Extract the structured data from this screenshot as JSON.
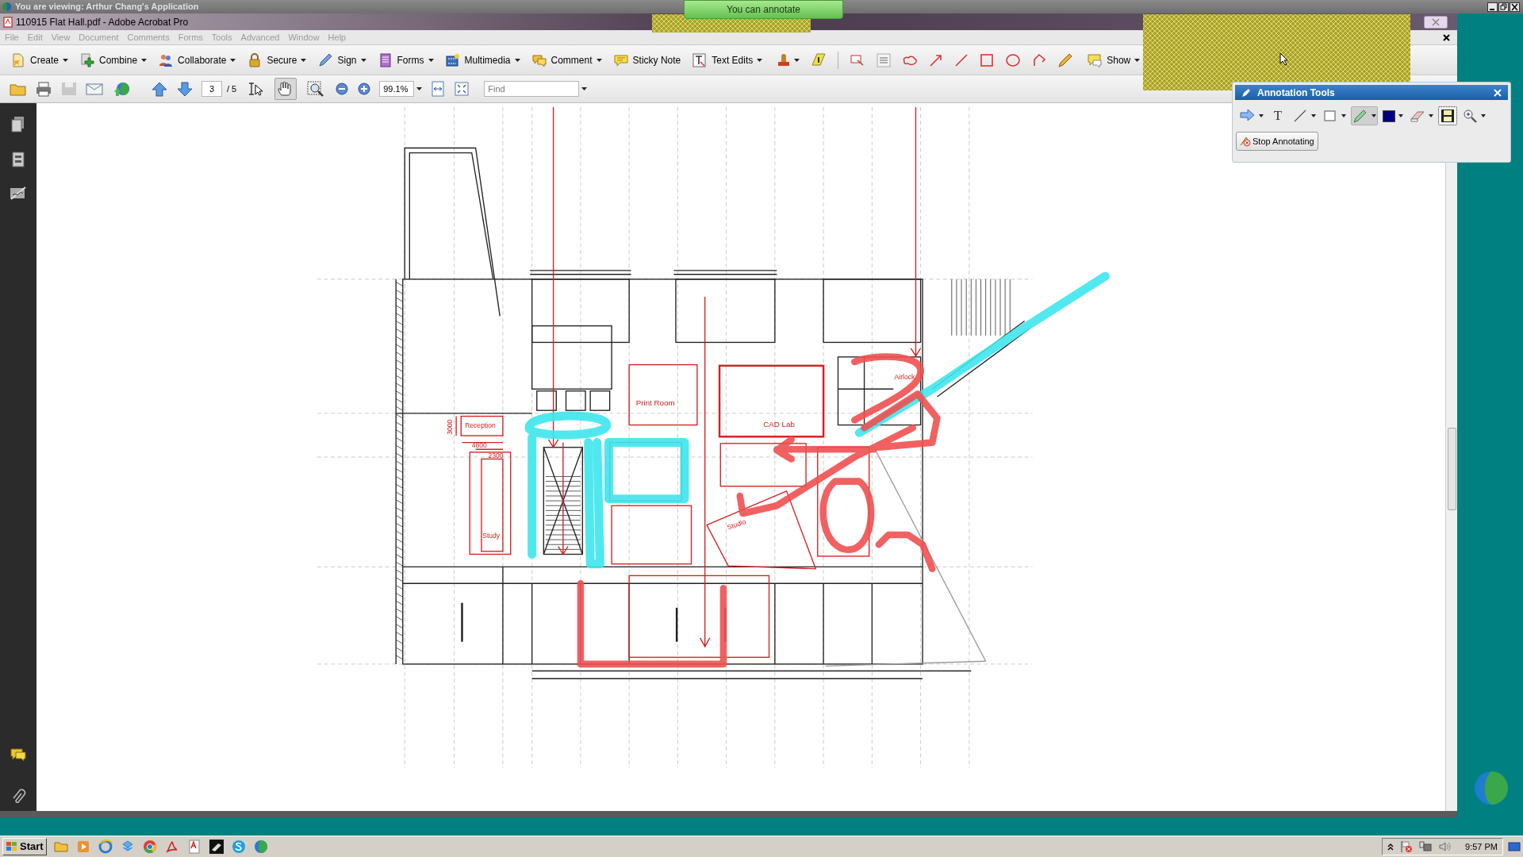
{
  "share_banner": {
    "text": "You are viewing: Arthur Chang's Application"
  },
  "toast": {
    "text": "You can annotate"
  },
  "window": {
    "title": "110915 Flat Hall.pdf - Adobe Acrobat Pro"
  },
  "menu": [
    {
      "label": "File",
      "disabled": true
    },
    {
      "label": "Edit",
      "disabled": true
    },
    {
      "label": "View",
      "disabled": true
    },
    {
      "label": "Document",
      "disabled": true
    },
    {
      "label": "Comments",
      "disabled": true
    },
    {
      "label": "Forms",
      "disabled": true
    },
    {
      "label": "Tools",
      "disabled": true
    },
    {
      "label": "Advanced",
      "disabled": true
    },
    {
      "label": "Window",
      "disabled": true
    },
    {
      "label": "Help",
      "disabled": true
    }
  ],
  "toolbar": [
    {
      "label": "Create",
      "dropdown": true
    },
    {
      "label": "Combine",
      "dropdown": true
    },
    {
      "label": "Collaborate",
      "dropdown": true
    },
    {
      "label": "Secure",
      "dropdown": true
    },
    {
      "label": "Sign",
      "dropdown": true
    },
    {
      "label": "Forms",
      "dropdown": true
    },
    {
      "label": "Multimedia",
      "dropdown": true
    },
    {
      "label": "Comment",
      "dropdown": true
    },
    {
      "label": "Sticky Note",
      "dropdown": false
    },
    {
      "label": "Text Edits",
      "dropdown": true
    },
    {
      "label": "Show",
      "dropdown": true
    }
  ],
  "navigation": {
    "page": "3",
    "page_count": "/ 5",
    "zoom": "99.1%",
    "find_placeholder": "Find"
  },
  "view_tools": [
    {
      "kind": "select",
      "selected": false
    },
    {
      "kind": "hand",
      "selected": true
    },
    {
      "kind": "zoom",
      "selected": false
    }
  ],
  "document": {
    "labels": [
      {
        "text": "Print Room"
      },
      {
        "text": "CAD Lab"
      },
      {
        "text": "Reception"
      },
      {
        "text": "Study"
      },
      {
        "text": "Studio"
      },
      {
        "text": "Airlock"
      },
      {
        "text": "3000"
      },
      {
        "text": "4800"
      },
      {
        "text": "2300"
      }
    ]
  },
  "annotation_tools": {
    "title": "Annotation Tools",
    "tools": [
      {
        "kind": "arrow",
        "dropdown": true,
        "selected": false,
        "focused": false
      },
      {
        "kind": "text",
        "glyph": "T",
        "dropdown": false,
        "selected": false,
        "focused": false
      },
      {
        "kind": "line",
        "dropdown": true,
        "selected": false,
        "focused": false
      },
      {
        "kind": "rectangle",
        "dropdown": true,
        "selected": false,
        "focused": false
      },
      {
        "kind": "pencil",
        "dropdown": true,
        "selected": true,
        "focused": false
      },
      {
        "kind": "color",
        "color": "#000080",
        "dropdown": true,
        "selected": false,
        "focused": false
      },
      {
        "kind": "eraser",
        "dropdown": true,
        "selected": false,
        "focused": false
      },
      {
        "kind": "save",
        "dropdown": false,
        "selected": false,
        "focused": true
      },
      {
        "kind": "zoom",
        "dropdown": true,
        "selected": false,
        "focused": false
      }
    ],
    "button": "Stop Annotating"
  },
  "taskbar": {
    "start": "Start",
    "clock": "9:57 PM"
  }
}
